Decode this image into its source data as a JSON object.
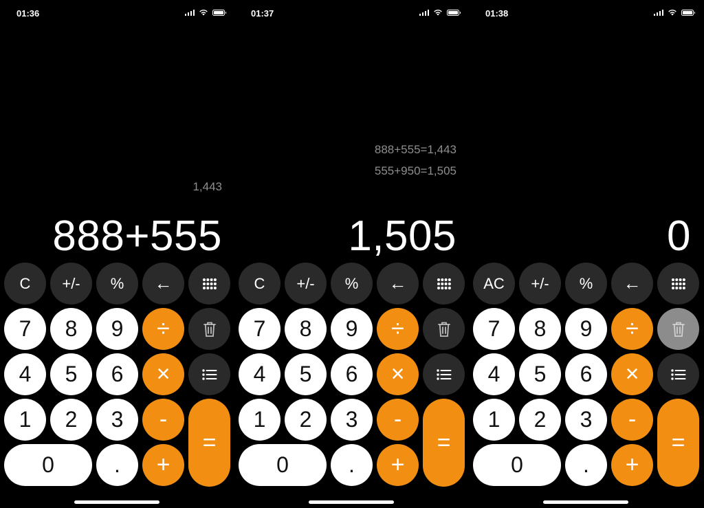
{
  "screens": [
    {
      "time": "01:36",
      "history": [
        "1,443"
      ],
      "display": "888+555",
      "clear_label": "C"
    },
    {
      "time": "01:37",
      "history": [
        "888+555=1,443",
        "555+950=1,505"
      ],
      "display": "1,505",
      "clear_label": "C"
    },
    {
      "time": "01:38",
      "history": [],
      "display": "0",
      "clear_label": "AC"
    }
  ],
  "keys": {
    "toggle_sign": "+/-",
    "percent": "%",
    "backspace": "←",
    "seven": "7",
    "eight": "8",
    "nine": "9",
    "four": "4",
    "five": "5",
    "six": "6",
    "one": "1",
    "two": "2",
    "three": "3",
    "zero": "0",
    "decimal": ".",
    "divide": "÷",
    "multiply": "×",
    "subtract": "-",
    "add": "+",
    "equals": "="
  },
  "icons": {
    "grid": "grid-icon",
    "trash": "trash-icon",
    "list": "list-icon"
  },
  "colors": {
    "background": "#000000",
    "function_key": "#2a2a2a",
    "number_key": "#ffffff",
    "operator_key": "#f28f12",
    "history_text": "#8e8e8e",
    "trash_active": "#8c8c8c"
  }
}
